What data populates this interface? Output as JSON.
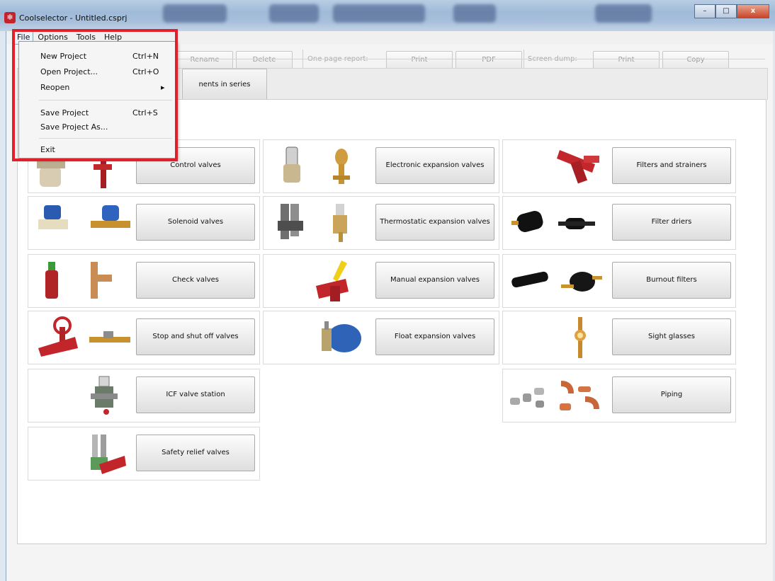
{
  "window": {
    "title": "Coolselector - Untitled.csprj",
    "app_icon": "coolselector-logo"
  },
  "window_controls": {
    "minimize": "–",
    "maximize": "□",
    "close": "x"
  },
  "menubar": {
    "file": "File",
    "options": "Options",
    "tools": "Tools",
    "help": "Help"
  },
  "toolbar": {
    "rename": "Rename",
    "delete": "Delete",
    "one_page_report_label": "One page report:",
    "report_print": "Print",
    "report_pdf": "PDF",
    "screen_dump_label": "Screen dump:",
    "dump_print": "Print",
    "dump_copy": "Copy"
  },
  "tabs": {
    "components_in_series": "nents in series"
  },
  "file_menu": {
    "new_project": "New Project",
    "new_project_shortcut": "Ctrl+N",
    "open_project": "Open Project...",
    "open_project_shortcut": "Ctrl+O",
    "reopen": "Reopen",
    "reopen_arrow": "▸",
    "save_project": "Save Project",
    "save_project_shortcut": "Ctrl+S",
    "save_project_as": "Save Project As...",
    "exit": "Exit"
  },
  "components": {
    "control_valves": "Control valves",
    "electronic_expansion_valves": "Electronic expansion valves",
    "filters_and_strainers": "Filters and strainers",
    "solenoid_valves": "Solenoid valves",
    "thermostatic_expansion_valves": "Thermostatic expansion valves",
    "filter_driers": "Filter driers",
    "check_valves": "Check valves",
    "manual_expansion_valves": "Manual expansion valves",
    "burnout_filters": "Burnout filters",
    "stop_and_shut_off_valves": "Stop and shut off valves",
    "float_expansion_valves": "Float expansion valves",
    "sight_glasses": "Sight glasses",
    "icf_valve_station": "ICF valve station",
    "piping": "Piping",
    "safety_relief_valves": "Safety relief valves"
  },
  "annotation": {
    "highlight_color": "#e2202b"
  }
}
